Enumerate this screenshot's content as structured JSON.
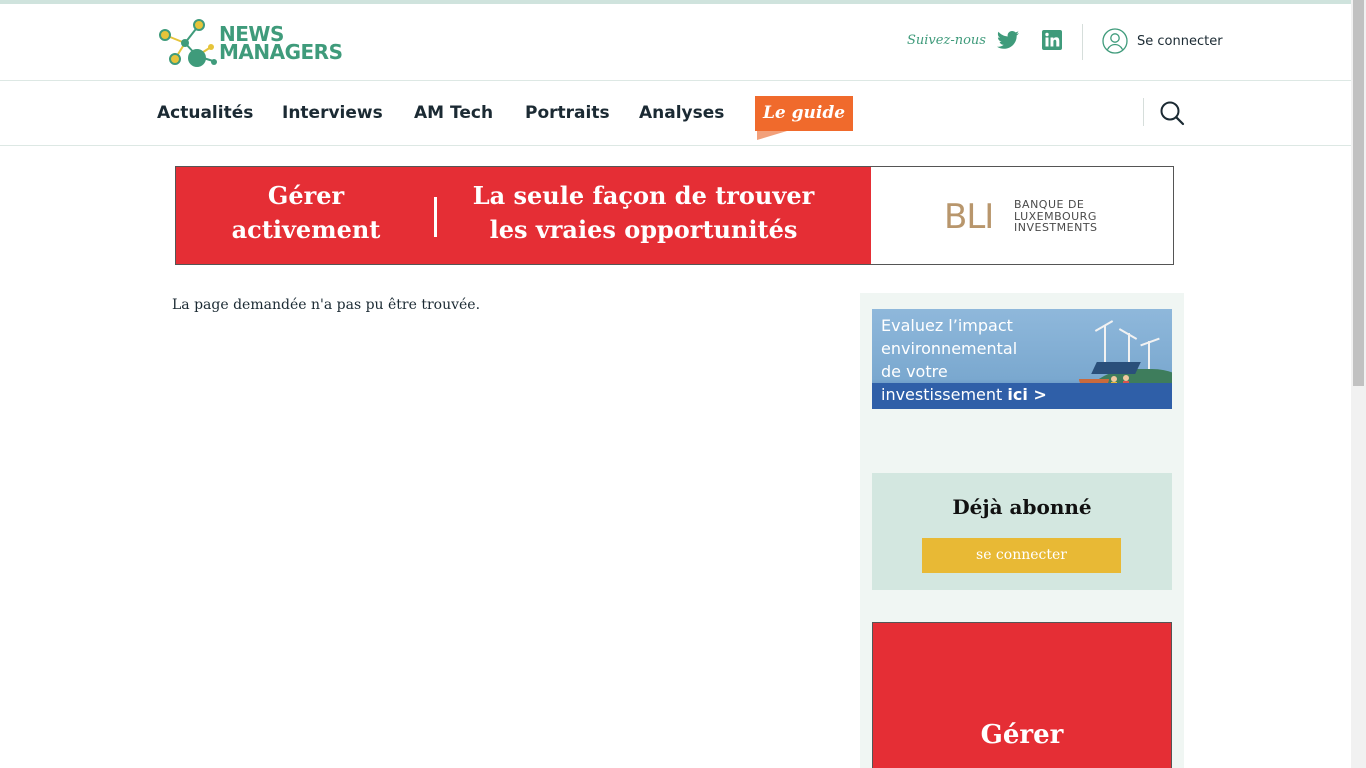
{
  "site": {
    "logo_line1": "NEWS",
    "logo_line2": "MANAGERS",
    "brand_color": "#3f9b7b"
  },
  "header": {
    "follow_label": "Suivez-nous",
    "social": [
      "twitter-icon",
      "linkedin-icon"
    ],
    "login_label": "Se connecter"
  },
  "nav": {
    "items": [
      "Actualités",
      "Interviews",
      "AM Tech",
      "Portraits",
      "Analyses"
    ],
    "guide_label": "Le guide",
    "guide_color": "#f06a2c"
  },
  "banner_ad": {
    "left_line1": "Gérer",
    "left_line2": "activement",
    "right_line1": "La seule façon de trouver",
    "right_line2": "les vraies opportunités",
    "brand_mark": "BLI",
    "brand_line1": "BANQUE DE",
    "brand_line2": "LUXEMBOURG",
    "brand_line3": "INVESTMENTS",
    "color": "#e52e35"
  },
  "main": {
    "message": "La page demandée n'a pas pu être trouvée."
  },
  "sidebar": {
    "env_ad_line1": "Evaluez l’impact",
    "env_ad_line2": "environnemental",
    "env_ad_line3": "de votre",
    "env_ad_line4": "investissement",
    "env_ad_cta": "ici >",
    "subscriber_title": "Déjà abonné",
    "subscriber_button": "se connecter",
    "subscriber_button_color": "#e8b935",
    "side_ad_text": "Gérer"
  }
}
